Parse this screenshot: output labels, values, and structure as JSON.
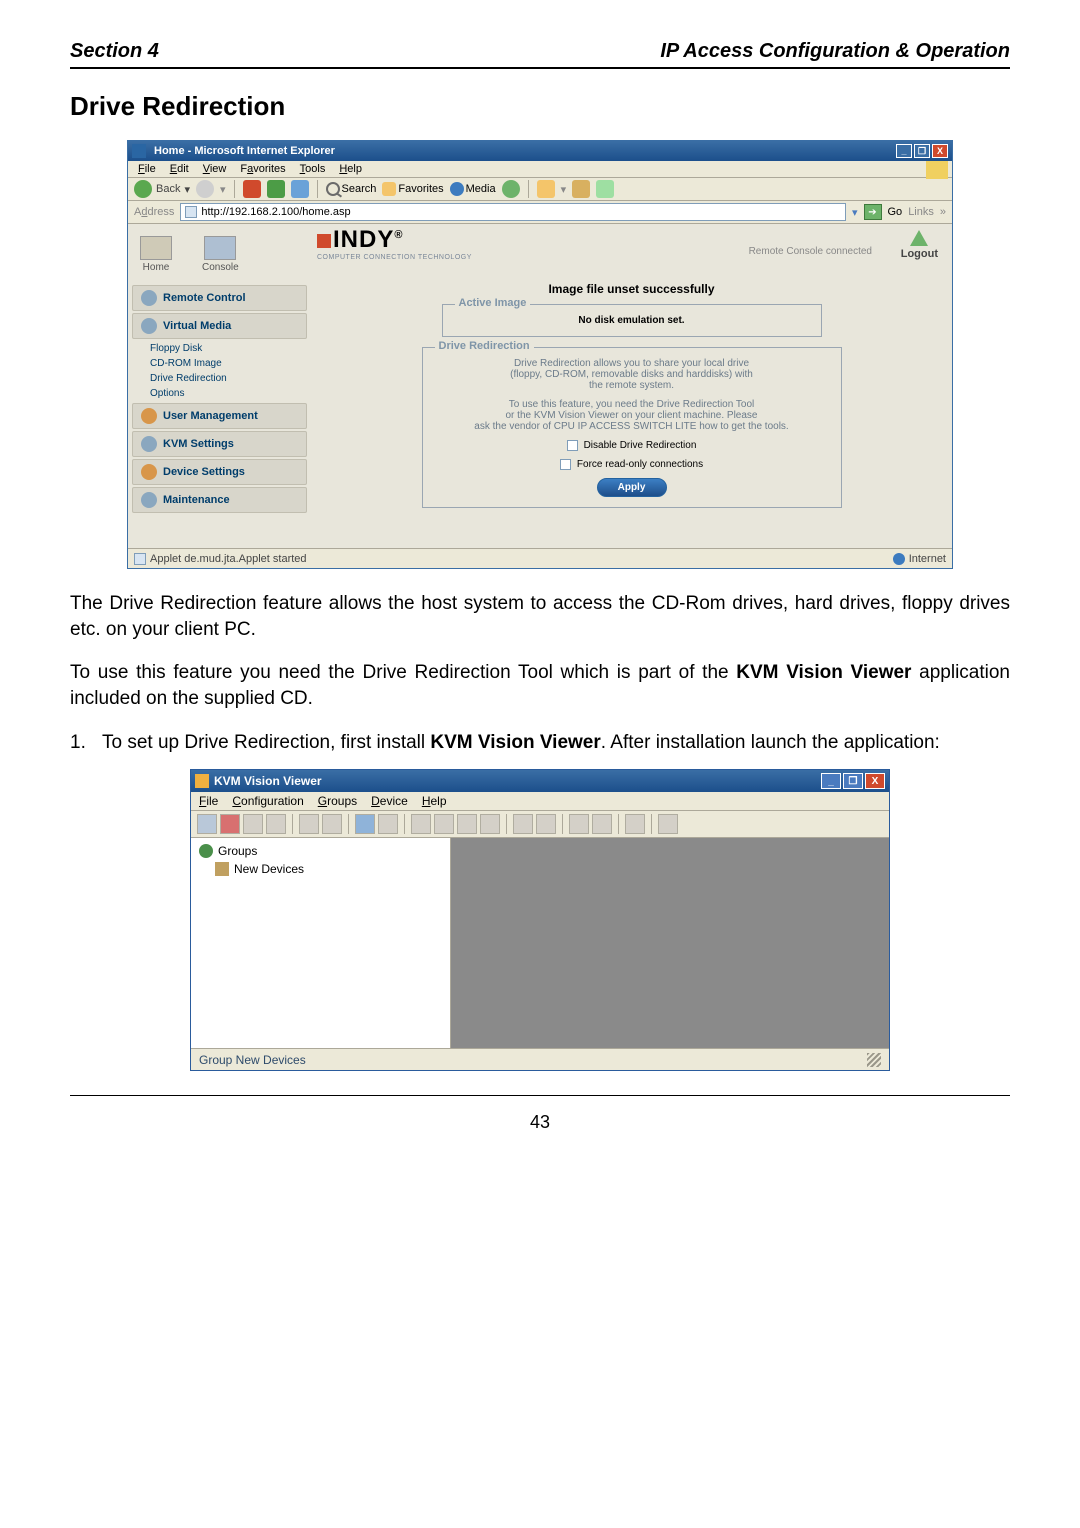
{
  "header": {
    "left": "Section 4",
    "right": "IP Access Configuration & Operation"
  },
  "title": "Drive Redirection",
  "ie": {
    "title": "Home - Microsoft Internet Explorer",
    "win_min": "_",
    "win_max": "❐",
    "win_close": "X",
    "menu": {
      "file": "File",
      "edit": "Edit",
      "view": "View",
      "favorites": "Favorites",
      "tools": "Tools",
      "help": "Help"
    },
    "toolbar": {
      "back": "Back",
      "search": "Search",
      "favorites": "Favorites",
      "media": "Media"
    },
    "address_label": "Address",
    "address_url": "http://192.168.2.100/home.asp",
    "go": "Go",
    "links": "Links",
    "home": "Home",
    "console": "Console",
    "logo_letters": "INDY",
    "logo_sub": "COMPUTER CONNECTION TECHNOLOGY",
    "remote_status": "Remote Console connected",
    "logout": "Logout",
    "nav": {
      "remote_control": "Remote Control",
      "virtual_media": "Virtual Media",
      "floppy": "Floppy Disk",
      "cdrom": "CD-ROM Image",
      "drive_redir": "Drive Redirection",
      "options": "Options",
      "user_mgmt": "User Management",
      "kvm_settings": "KVM Settings",
      "device_settings": "Device Settings",
      "maintenance": "Maintenance"
    },
    "success": "Image file unset successfully",
    "active_legend": "Active Image",
    "no_disk": "No disk emulation set.",
    "dr_legend": "Drive Redirection",
    "dr_line1": "Drive Redirection allows you to share your local drive",
    "dr_line2": "(floppy, CD-ROM, removable disks and harddisks) with",
    "dr_line3": "the remote system.",
    "dr_line4": "To use this feature, you need the Drive Redirection Tool",
    "dr_line5": "or the KVM Vision Viewer on your client machine. Please",
    "dr_line6": "ask the vendor of CPU IP ACCESS SWITCH LITE how to get the tools.",
    "chk_disable": "Disable Drive Redirection",
    "chk_readonly": "Force read-only connections",
    "apply": "Apply",
    "status_left": "Applet de.mud.jta.Applet started",
    "status_right": "Internet"
  },
  "para1": "The Drive Redirection feature allows the host system to access the CD-Rom drives, hard drives, floppy drives etc. on your client PC.",
  "para2a": "To use this feature you need the Drive Redirection Tool which is part of the ",
  "para2b": "KVM Vision Viewer",
  "para2c": " application included on the supplied CD.",
  "step1_num": "1.",
  "step1a": "To set up Drive Redirection, first install ",
  "step1b": "KVM Vision Viewer",
  "step1c": ". After installation launch the application:",
  "kvm": {
    "title": "KVM Vision Viewer",
    "win_min": "_",
    "win_max": "❐",
    "win_close": "X",
    "menu": {
      "file": "File",
      "config": "Configuration",
      "groups": "Groups",
      "device": "Device",
      "help": "Help"
    },
    "tree_groups": "Groups",
    "tree_new_devices": "New Devices",
    "status": "Group New Devices"
  },
  "page_number": "43"
}
